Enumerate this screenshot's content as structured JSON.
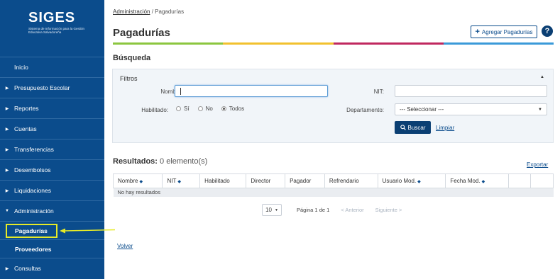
{
  "app": {
    "logo_title": "SIGES",
    "logo_subtitle": "Sistema de Información para la Gestión Educativa Salvadoreña"
  },
  "sidebar": {
    "items": [
      {
        "label": "Inicio"
      },
      {
        "label": "Presupuesto Escolar"
      },
      {
        "label": "Reportes"
      },
      {
        "label": "Cuentas"
      },
      {
        "label": "Transferencias"
      },
      {
        "label": "Desembolsos"
      },
      {
        "label": "Liquidaciones"
      },
      {
        "label": "Administración"
      },
      {
        "label": "Pagadurías"
      },
      {
        "label": "Proveedores"
      },
      {
        "label": "Consultas"
      }
    ]
  },
  "breadcrumb": {
    "parent": "Administración",
    "separator": "/",
    "current": "Pagadurías"
  },
  "header": {
    "title": "Pagadurías",
    "add_button": "Agregar Pagadurías",
    "help": "?"
  },
  "search": {
    "section_title": "Búsqueda",
    "filters_title": "Filtros",
    "nombre_label": "Nombre:",
    "nombre_value": "",
    "nit_label": "NIT:",
    "nit_value": "",
    "habilitado_label": "Habilitado:",
    "radio_si": "Sí",
    "radio_no": "No",
    "radio_todos": "Todos",
    "departamento_label": "Departamento:",
    "departamento_value": "--- Seleccionar ---",
    "search_button": "Buscar",
    "clear_link": "Limpiar"
  },
  "results": {
    "title": "Resultados:",
    "count": "0 elemento(s)",
    "export": "Exportar",
    "columns": [
      "Nombre",
      "NIT",
      "Habilitado",
      "Director",
      "Pagador",
      "Refrendario",
      "Usuario Mod.",
      "Fecha Mod."
    ],
    "empty_message": "No hay resultados"
  },
  "pager": {
    "page_size": "10",
    "page_info": "Página 1 de 1",
    "prev": "< Anterior",
    "next": "Siguiente >"
  },
  "footer": {
    "back": "Volver"
  },
  "colors": {
    "sidebar": "#0b4c8c",
    "accent_green": "#8cc63f",
    "accent_yellow": "#f2c12e",
    "accent_red": "#c0285f",
    "accent_blue": "#3b9ad9",
    "highlight": "#e6ea27"
  }
}
